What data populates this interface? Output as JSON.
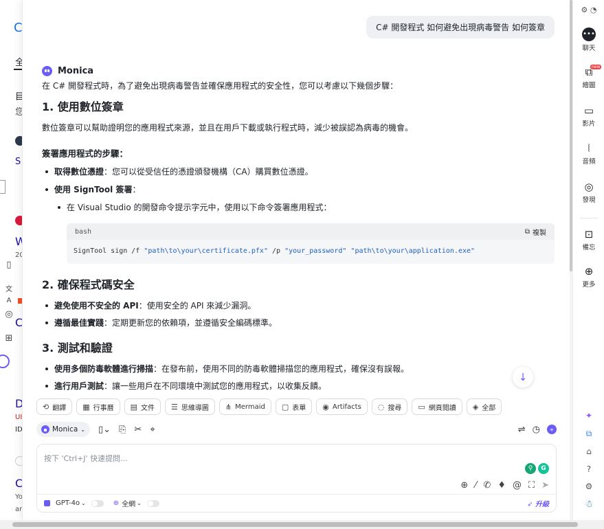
{
  "user_message": "C# 開發程式 如何避免出現病毒警告 如何簽章",
  "assistant": {
    "name": "Monica",
    "intro": "在 C# 開發程式時，為了避免出現病毒警告並確保應用程式的安全性，您可以考慮以下幾個步驟：",
    "s1": {
      "title": "1. 使用數位簽章",
      "para": "數位簽章可以幫助證明您的應用程式來源，並且在用戶下載或執行程式時，減少被誤認為病毒的機會。",
      "subtitle": "簽署應用程式的步驟：",
      "b1_bold": "取得數位憑證",
      "b1_text": "：您可以從受信任的憑證頒發機構（CA）購買數位憑證。",
      "b2_bold": "使用 SignTool 簽署",
      "b2_text": "：",
      "sub1": "在 Visual Studio 的開發命令提示字元中，使用以下命令簽署應用程式："
    },
    "code": {
      "lang": "bash",
      "copy_label": "複製",
      "cmd1": "SignTool sign /f ",
      "arg1": "\"path\\to\\your\\certificate.pfx\"",
      "cmd2": " /p ",
      "arg2": "\"your_password\"",
      "cmd3": " ",
      "arg3": "\"path\\to\\your\\application.exe\""
    },
    "s2": {
      "title": "2. 確保程式碼安全",
      "b1_bold": "避免使用不安全的 API",
      "b1_text": "：使用安全的 API 來減少漏洞。",
      "b2_bold": "遵循最佳實踐",
      "b2_text": "：定期更新您的依賴項，並遵循安全編碼標準。"
    },
    "s3": {
      "title": "3. 測試和驗證",
      "b1_bold": "使用多個防毒軟體進行掃描",
      "b1_text": "：在發布前，使用不同的防毒軟體掃描您的應用程式，確保沒有誤報。",
      "b2_bold": "進行用戶測試",
      "b2_text": "：讓一些用戶在不同環境中測試您的應用程式，以收集反饋。"
    }
  },
  "tools": [
    "翻譯",
    "行事曆",
    "文件",
    "思維導圖",
    "Mermaid",
    "表單",
    "Artifacts",
    "搜尋",
    "網頁閱讀",
    "全部"
  ],
  "model_selector": "Monica",
  "input": {
    "placeholder": "按下 'Ctrl+J' 快速提問...",
    "model": "GPT-4o",
    "web_label": "全網",
    "upgrade": "升級"
  },
  "sidebar": {
    "chat": "聊天",
    "draw": "繪圖",
    "video": "影片",
    "audio": "音頻",
    "discover": "發現",
    "memo": "備忘",
    "more": "更多",
    "draw_badge": "new"
  },
  "bg_page": {
    "t1": "全",
    "t2": "目",
    "t3": "您",
    "t4": "S",
    "t5": "W",
    "t6": "20",
    "t7": "C",
    "t8": "D",
    "t9": "UI",
    "t10": "ID",
    "t11": "C",
    "t12": "Yo",
    "t13": "ar"
  }
}
